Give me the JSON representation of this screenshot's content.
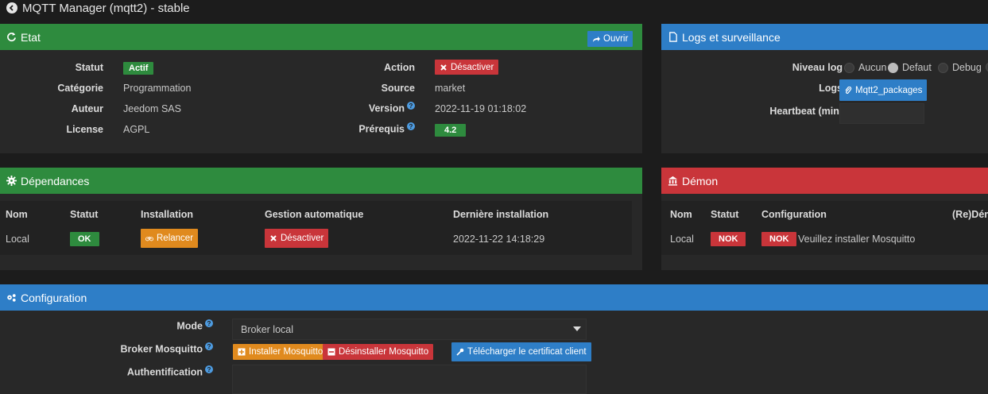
{
  "page_title": "MQTT Manager (mqtt2) - stable",
  "etat": {
    "title": "Etat",
    "open_button": "Ouvrir",
    "statut_label": "Statut",
    "statut_value": "Actif",
    "categorie_label": "Catégorie",
    "categorie_value": "Programmation",
    "auteur_label": "Auteur",
    "auteur_value": "Jeedom SAS",
    "license_label": "License",
    "license_value": "AGPL",
    "action_label": "Action",
    "action_button": "Désactiver",
    "source_label": "Source",
    "source_value": "market",
    "version_label": "Version",
    "version_value": "2022-11-19 01:18:02",
    "prerequis_label": "Prérequis",
    "prerequis_value": "4.2"
  },
  "logs": {
    "title": "Logs et surveillance",
    "niveau_label": "Niveau log",
    "options": [
      "Aucun",
      "Defaut",
      "Debug"
    ],
    "selected": "Defaut",
    "logs_label": "Logs",
    "logs_button": "Mqtt2_packages",
    "heartbeat_label": "Heartbeat (min)",
    "heartbeat_value": ""
  },
  "dependances": {
    "title": "Dépendances",
    "columns": [
      "Nom",
      "Statut",
      "Installation",
      "Gestion automatique",
      "Dernière installation"
    ],
    "row": {
      "nom": "Local",
      "statut": "OK",
      "installation_button": "Relancer",
      "gestion_button": "Désactiver",
      "derniere": "2022-11-22 14:18:29"
    }
  },
  "demon": {
    "title": "Démon",
    "columns": [
      "Nom",
      "Statut",
      "Configuration",
      "(Re)Dém"
    ],
    "row": {
      "nom": "Local",
      "statut": "NOK",
      "config_badge": "NOK",
      "config_text": "Veuillez installer Mosquitto"
    }
  },
  "configuration": {
    "title": "Configuration",
    "mode_label": "Mode",
    "mode_value": "Broker local",
    "broker_label": "Broker Mosquitto",
    "install_button": "Installer Mosquitto",
    "uninstall_button": "Désinstaller Mosquitto",
    "cert_button": "Télécharger le certificat client",
    "auth_label": "Authentification"
  },
  "colors": {
    "green": "#2e8b3e",
    "blue": "#2e7ec7",
    "red": "#c9353a",
    "orange": "#e08a1e"
  }
}
